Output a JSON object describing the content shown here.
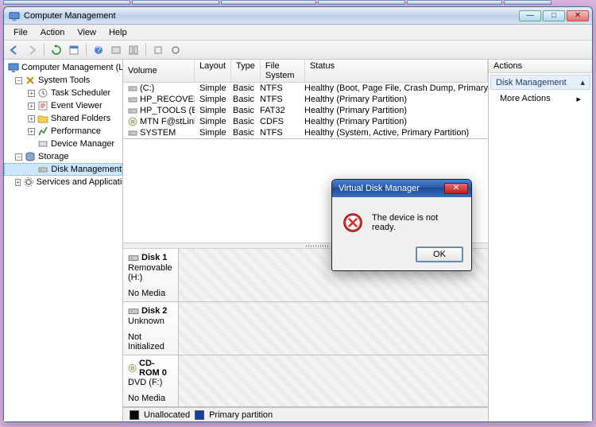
{
  "window": {
    "title": "Computer Management"
  },
  "menu": [
    "File",
    "Action",
    "View",
    "Help"
  ],
  "tree": {
    "root": "Computer Management (Local)",
    "systools": "System Tools",
    "tasksched": "Task Scheduler",
    "eventvwr": "Event Viewer",
    "shared": "Shared Folders",
    "perf": "Performance",
    "devmgr": "Device Manager",
    "storage": "Storage",
    "diskmgmt": "Disk Management",
    "services": "Services and Applications"
  },
  "vol_headers": {
    "vol": "Volume",
    "lay": "Layout",
    "typ": "Type",
    "fs": "File System",
    "st": "Status"
  },
  "volumes": [
    {
      "name": "(C:)",
      "layout": "Simple",
      "type": "Basic",
      "fs": "NTFS",
      "status": "Healthy (Boot, Page File, Crash Dump, Primary Partition)",
      "icon": "disk"
    },
    {
      "name": "HP_RECOVERY",
      "layout": "Simple",
      "type": "Basic",
      "fs": "NTFS",
      "status": "Healthy (Primary Partition)",
      "icon": "disk"
    },
    {
      "name": "HP_TOOLS (E:)",
      "layout": "Simple",
      "type": "Basic",
      "fs": "FAT32",
      "status": "Healthy (Primary Partition)",
      "icon": "disk"
    },
    {
      "name": "MTN F@stLink (G:)",
      "layout": "Simple",
      "type": "Basic",
      "fs": "CDFS",
      "status": "Healthy (Primary Partition)",
      "icon": "cd"
    },
    {
      "name": "SYSTEM",
      "layout": "Simple",
      "type": "Basic",
      "fs": "NTFS",
      "status": "Healthy (System, Active, Primary Partition)",
      "icon": "disk"
    }
  ],
  "disks": [
    {
      "name": "Disk 1",
      "sub": "Removable (H:)",
      "note": "No Media"
    },
    {
      "name": "Disk 2",
      "sub": "Unknown",
      "note": "Not Initialized"
    },
    {
      "name": "CD-ROM 0",
      "sub": "DVD (F:)",
      "note": "No Media"
    }
  ],
  "legend": {
    "unalloc": "Unallocated",
    "primary": "Primary partition"
  },
  "actions": {
    "title": "Actions",
    "category": "Disk Management",
    "more": "More Actions"
  },
  "dialog": {
    "title": "Virtual Disk Manager",
    "message": "The device is not ready.",
    "ok": "OK"
  }
}
